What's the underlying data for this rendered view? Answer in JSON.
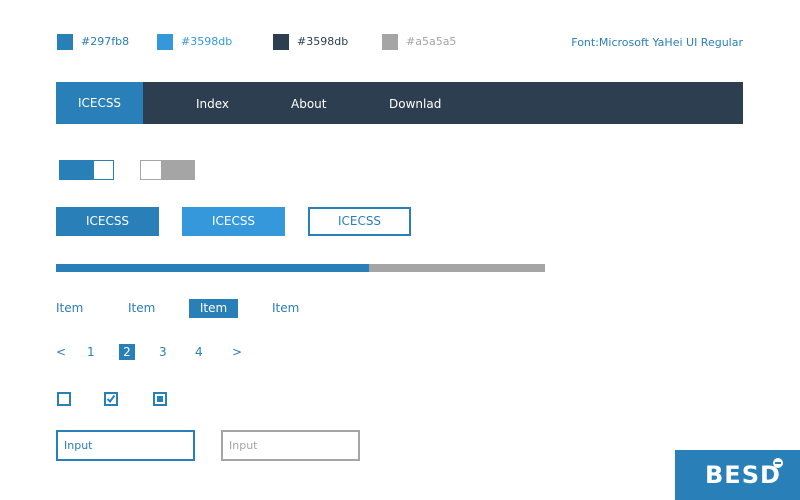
{
  "swatches": [
    {
      "color": "#297fb8",
      "label": "#297fb8",
      "text_color": "#297fb8"
    },
    {
      "color": "#3598db",
      "label": "#3598db",
      "text_color": "#3598db"
    },
    {
      "color": "#2c3e50",
      "label": "#3598db",
      "text_color": "#2c3e50"
    },
    {
      "color": "#a5a5a5",
      "label": "#a5a5a5",
      "text_color": "#a5a5a5"
    }
  ],
  "font_label": "Font:Microsoft YaHei UI Regular",
  "navbar": {
    "brand": "ICECSS",
    "links": [
      "Index",
      "About",
      "Downlad"
    ]
  },
  "toggles": [
    {
      "state": "on"
    },
    {
      "state": "off"
    }
  ],
  "buttons": {
    "primary": "ICECSS",
    "light": "ICECSS",
    "outline": "ICECSS"
  },
  "progress": {
    "value": 0.64
  },
  "tabs": {
    "items": [
      "Item",
      "Item",
      "Item",
      "Item"
    ],
    "active_index": 2
  },
  "pagination": {
    "prev": "<",
    "pages": [
      "1",
      "2",
      "3",
      "4"
    ],
    "next": ">",
    "current": "2"
  },
  "checkboxes": [
    {
      "state": "unchecked"
    },
    {
      "state": "checked"
    },
    {
      "state": "indeterminate"
    }
  ],
  "inputs": {
    "active_placeholder": "Input",
    "disabled_placeholder": "Input"
  },
  "logo": {
    "text": "BESD",
    "badge_icon": "chat-bubble-icon"
  },
  "colors": {
    "primary": "#297fb8",
    "light": "#3598db",
    "dark": "#2c3e50",
    "gray": "#a5a5a5"
  }
}
